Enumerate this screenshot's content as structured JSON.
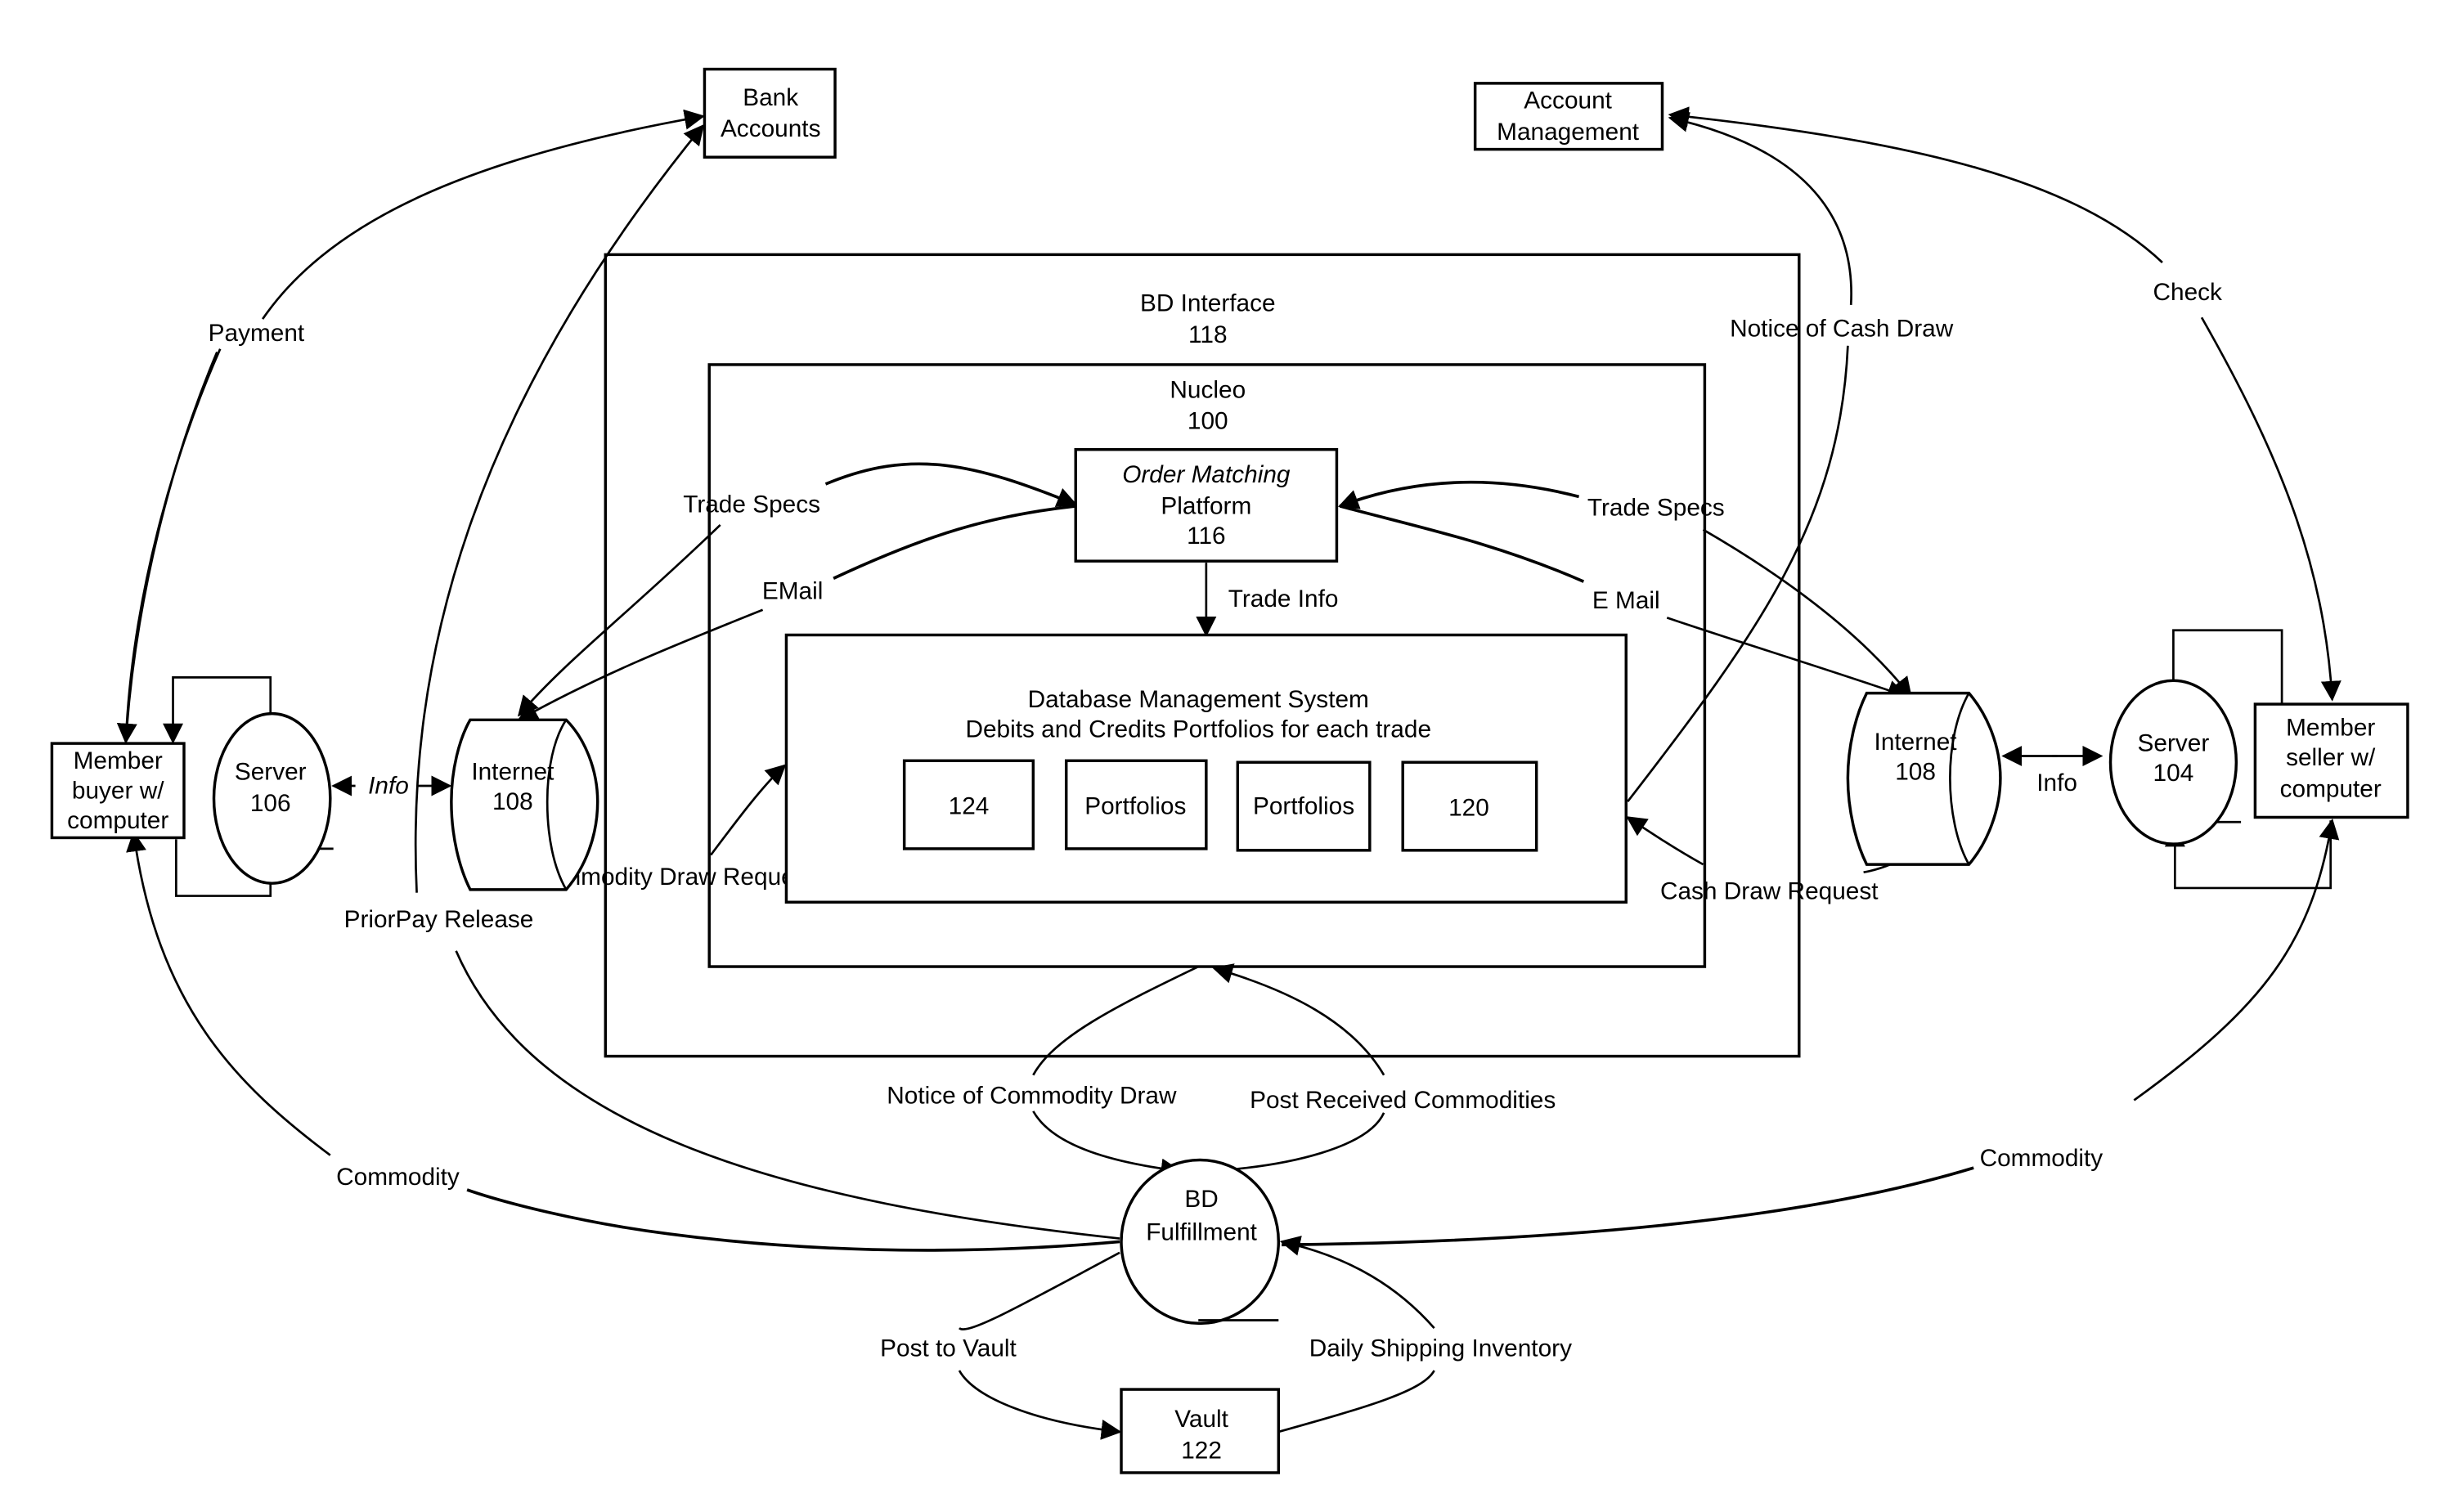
{
  "diagram": {
    "nodes": {
      "bank_accounts": {
        "line1": "Bank",
        "line2": "Accounts"
      },
      "account_management": {
        "line1": "Account",
        "line2": "Management"
      },
      "bd_interface": {
        "title": "BD Interface",
        "ref": "118"
      },
      "nucleo": {
        "title": "Nucleo",
        "ref": "100"
      },
      "order_matching": {
        "line1": "Order Matching",
        "line2": "Platform",
        "ref": "116"
      },
      "dbms": {
        "line1": "Database Management System",
        "line2": "Debits and Credits Portfolios for each trade",
        "cells": [
          "124",
          "Portfolios",
          "Portfolios",
          "120"
        ]
      },
      "member_buyer": {
        "line1": "Member",
        "line2": "buyer w/",
        "line3": "computer"
      },
      "server_106": {
        "line1": "Server",
        "line2": "106"
      },
      "internet_left": {
        "line1": "Internet",
        "line2": "108"
      },
      "internet_right": {
        "line1": "Internet",
        "line2": "108"
      },
      "server_104": {
        "line1": "Server",
        "line2": "104"
      },
      "member_seller": {
        "line1": "Member",
        "line2": "seller w/",
        "line3": "computer"
      },
      "bd_fulfillment": {
        "line1": "BD",
        "line2": "Fulfillment"
      },
      "vault": {
        "line1": "Vault",
        "line2": "122"
      }
    },
    "edge_labels": {
      "payment": "Payment",
      "check": "Check",
      "notice_of_cash_draw": "Notice of Cash Draw",
      "trade_specs_left": "Trade Specs",
      "trade_specs_right": "Trade Specs",
      "email_left": "EMail",
      "email_right": "E Mail",
      "trade_info": "Trade Info",
      "info_left": "Info",
      "info_right": "Info",
      "commodity_draw_request": "Commodity Draw Request",
      "cash_draw_request": "Cash Draw Request",
      "priorpay_release": "PriorPay Release",
      "notice_of_commodity_draw": "Notice of Commodity Draw",
      "post_received_commodities": "Post Received Commodities",
      "commodity_left": "Commodity",
      "commodity_right": "Commodity",
      "post_to_vault": "Post to Vault",
      "daily_shipping_inventory": "Daily Shipping Inventory"
    }
  }
}
